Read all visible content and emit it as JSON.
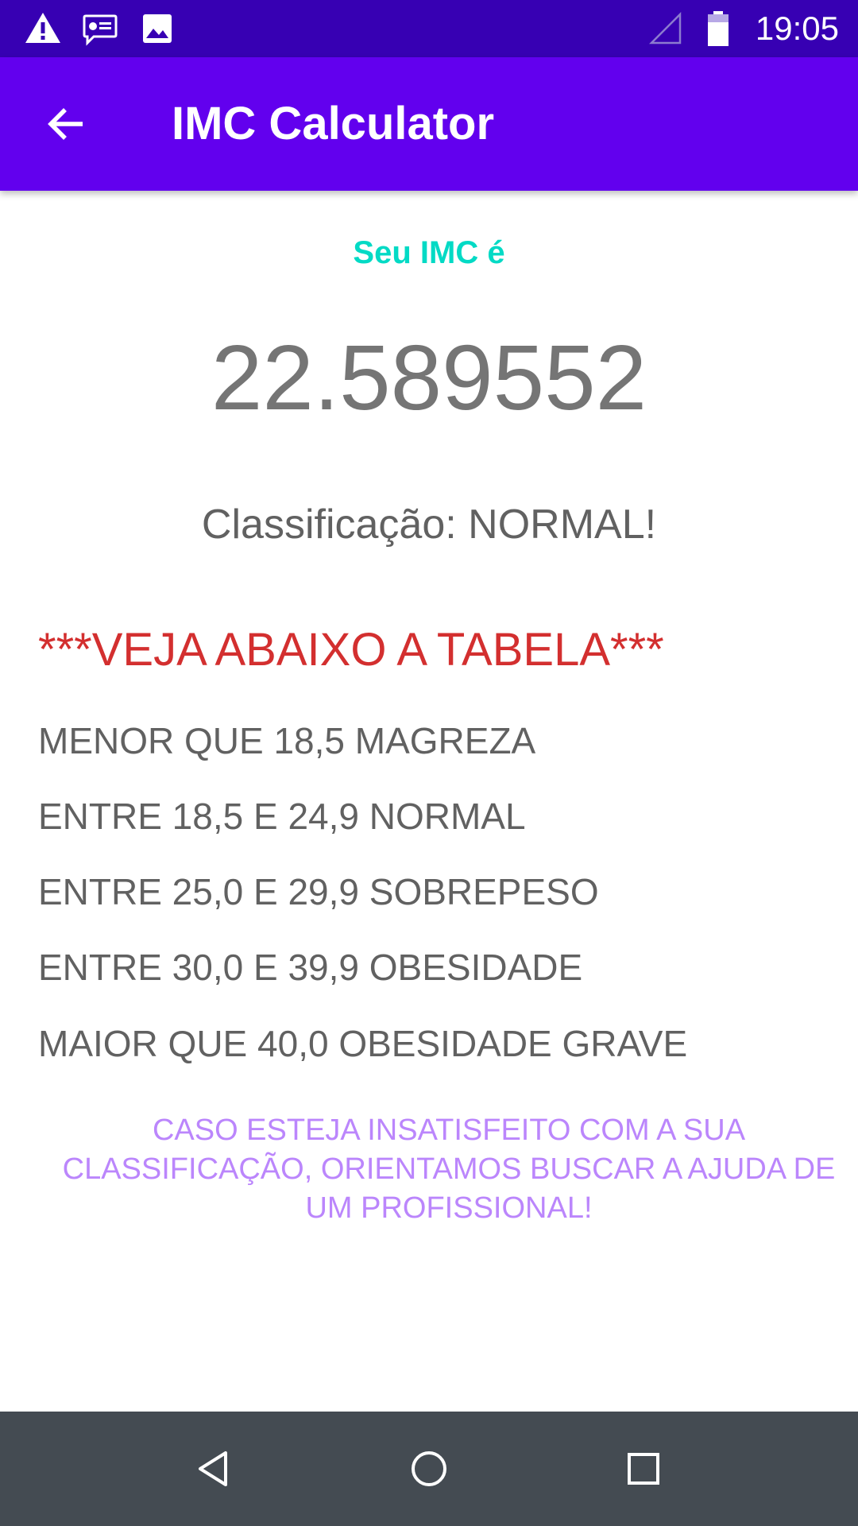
{
  "status_bar": {
    "time": "19:05",
    "left_icons": [
      "warning-icon",
      "message-icon",
      "image-icon"
    ],
    "right_icons": [
      "signal-icon",
      "battery-icon"
    ]
  },
  "app_bar": {
    "title": "IMC Calculator",
    "back_icon": "arrow-back-icon"
  },
  "result": {
    "label": "Seu IMC é",
    "value": "22.589552",
    "classification": "Classificação: NORMAL!"
  },
  "table": {
    "heading": "***VEJA ABAIXO A TABELA***",
    "rows": [
      "MENOR QUE 18,5 MAGREZA",
      "ENTRE 18,5 E 24,9 NORMAL",
      "ENTRE 25,0 E 29,9 SOBREPESO",
      "ENTRE 30,0 E 39,9 OBESIDADE",
      "MAIOR QUE 40,0 OBESIDADE GRAVE"
    ]
  },
  "advice": {
    "line1": "CASO ESTEJA INSATISFEITO COM A SUA",
    "line2": "CLASSIFICAÇÃO, ORIENTAMOS BUSCAR A AJUDA DE",
    "line3": "UM PROFISSIONAL!"
  },
  "nav_bar": {
    "icons": [
      "back-triangle-icon",
      "home-circle-icon",
      "recents-square-icon"
    ]
  },
  "colors": {
    "status_bar": "#3700B3",
    "app_bar": "#6200EE",
    "imc_label": "#03DAC5",
    "table_heading": "#D32F2F",
    "advice": "#BB86FC",
    "nav_bar": "#444B52"
  }
}
